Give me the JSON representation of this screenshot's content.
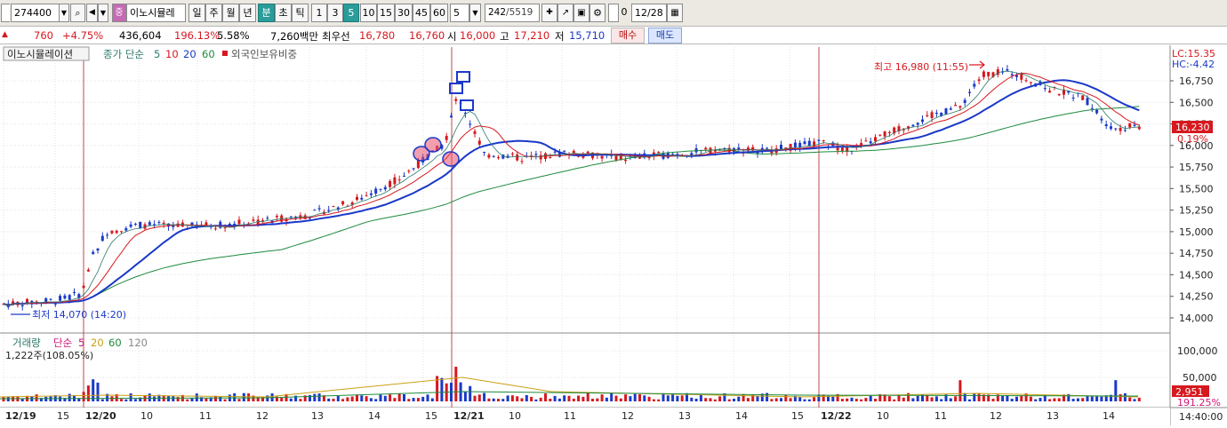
{
  "toolbar": {
    "code": "274400",
    "stock_name": "이노시뮬레",
    "periods": [
      "일",
      "주",
      "월",
      "년",
      "분",
      "초",
      "틱"
    ],
    "active_period": "분",
    "intervals": [
      "1",
      "3",
      "5",
      "10",
      "15",
      "30",
      "45",
      "60"
    ],
    "active_interval": "5",
    "interval_select": "5",
    "count": "242",
    "total": "/5519",
    "date": "12/28"
  },
  "quote": {
    "change": "760",
    "change_pct": "+4.75%",
    "volume": "436,604",
    "volume_ratio": "196.13%",
    "turnover": "5.58%",
    "amount": "7,260백만",
    "best_label": "최우선",
    "best_ask": "16,780",
    "best_bid": "16,760",
    "open_label": "시",
    "open": "16,000",
    "high_label": "고",
    "high": "17,210",
    "low_label": "저",
    "low": "15,710",
    "buy_label": "매수",
    "sell_label": "매도"
  },
  "price_panel": {
    "legend_name": "이노시뮬레이션",
    "legend_ma": "종가 단순",
    "ma_periods": [
      "5",
      "10",
      "20",
      "60"
    ],
    "foreign_label": "외국인보유비중",
    "lc": "LC:15.35",
    "hc": "HC:-4.42",
    "current_price": "16,230",
    "current_change": "0.19%",
    "high_note": "최고 16,980 (11:55)",
    "low_note": "최저 14,070 (14:20)",
    "y_ticks": [
      "16,750",
      "16,500",
      "16,250",
      "16,000",
      "15,750",
      "15,500",
      "15,250",
      "15,000",
      "14,750",
      "14,500",
      "14,250",
      "14,000"
    ]
  },
  "volume_panel": {
    "legend_name": "거래량",
    "legend_ma": "단순",
    "ma_periods": [
      "5",
      "20",
      "60",
      "120"
    ],
    "last_volume": "1,222주(108.05%)",
    "y_ticks": [
      "100,000",
      "50,000"
    ],
    "current_value": "2,951",
    "current_ratio": "191.25%"
  },
  "time_axis": {
    "labels": [
      "12/19",
      "15",
      "12/20",
      "10",
      "11",
      "12",
      "13",
      "14",
      "15",
      "12/21",
      "10",
      "11",
      "12",
      "13",
      "14",
      "15",
      "12/22",
      "10",
      "11",
      "12",
      "13",
      "14"
    ],
    "clock": "14:40:00"
  },
  "colors": {
    "up": "#d6181f",
    "down": "#1a39c9",
    "ma5": "#d6181f",
    "ma20": "#1a39c9",
    "ma60": "#1e8a3c",
    "accent": "#2a9d9b"
  }
}
